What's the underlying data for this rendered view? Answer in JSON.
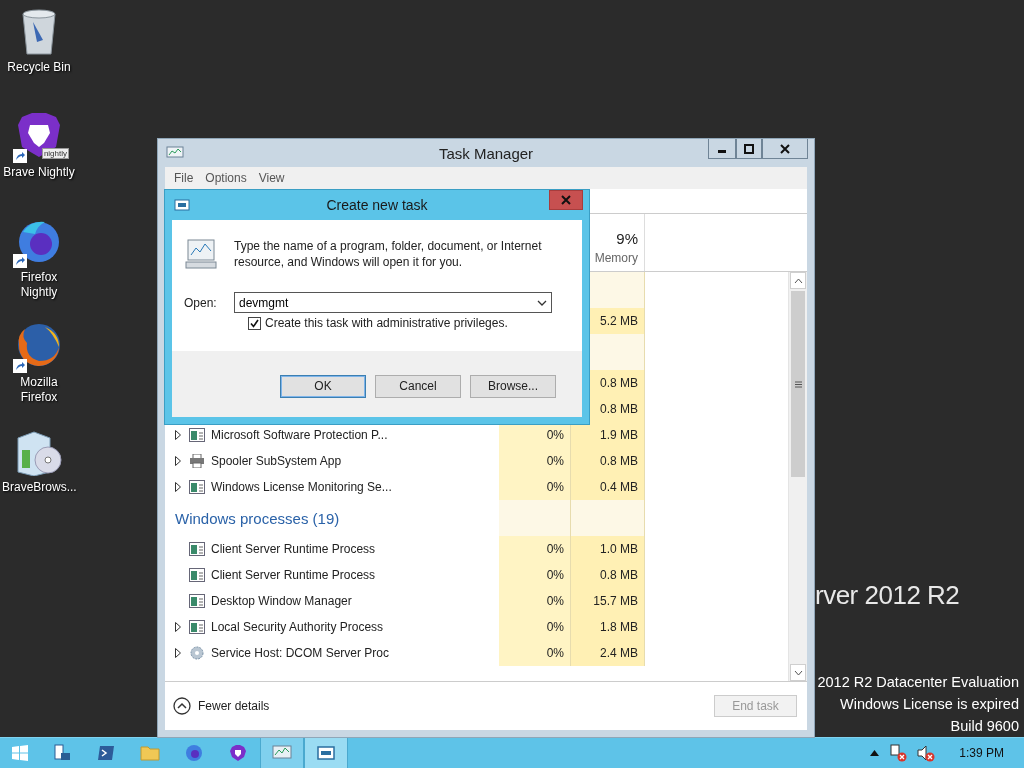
{
  "desktop_icons": [
    {
      "label": "Recycle Bin",
      "kind": "recycle",
      "shortcut": false
    },
    {
      "label": "Brave Nightly",
      "kind": "brave",
      "shortcut": true,
      "badge": "nightly"
    },
    {
      "label": "Firefox Nightly",
      "kind": "firefox-nightly",
      "shortcut": true
    },
    {
      "label": "Mozilla Firefox",
      "kind": "firefox",
      "shortcut": true
    },
    {
      "label": "BraveBrows...",
      "kind": "installer",
      "shortcut": false
    }
  ],
  "branding": {
    "title": "rver 2012 R2",
    "lines": [
      "2012 R2 Datacenter Evaluation",
      "Windows License is expired",
      "Build 9600"
    ]
  },
  "task_manager": {
    "title": "Task Manager",
    "menu": [
      "File",
      "Options",
      "View"
    ],
    "memory_header": {
      "percent": "9%",
      "label": "Memory"
    },
    "rows": [
      {
        "kind": "group"
      },
      {
        "kind": "covered",
        "memory": "5.2 MB"
      },
      {
        "kind": "group"
      },
      {
        "kind": "covered",
        "memory": "0.8 MB"
      },
      {
        "kind": "covered",
        "memory": "0.8 MB"
      },
      {
        "kind": "process",
        "name": "Microsoft Software Protection P...",
        "expandable": true,
        "cpu": "0%",
        "memory": "1.9 MB"
      },
      {
        "kind": "printer",
        "name": "Spooler SubSystem App",
        "expandable": true,
        "cpu": "0%",
        "memory": "0.8 MB"
      },
      {
        "kind": "process",
        "name": "Windows License Monitoring Se...",
        "expandable": true,
        "cpu": "0%",
        "memory": "0.4 MB"
      },
      {
        "kind": "group",
        "label": "Windows processes (19)"
      },
      {
        "kind": "process",
        "name": "Client Server Runtime Process",
        "expandable": false,
        "cpu": "0%",
        "memory": "1.0 MB"
      },
      {
        "kind": "process",
        "name": "Client Server Runtime Process",
        "expandable": false,
        "cpu": "0%",
        "memory": "0.8 MB"
      },
      {
        "kind": "process",
        "name": "Desktop Window Manager",
        "expandable": false,
        "cpu": "0%",
        "memory": "15.7 MB"
      },
      {
        "kind": "process",
        "name": "Local Security Authority Process",
        "expandable": true,
        "cpu": "0%",
        "memory": "1.8 MB"
      },
      {
        "kind": "service",
        "name": "Service Host: DCOM Server Proc",
        "expandable": true,
        "cpu": "0%",
        "memory": "2.4 MB"
      }
    ],
    "footer": {
      "toggle": "Fewer details",
      "end_task": {
        "label": "End task",
        "disabled": true
      }
    }
  },
  "dialog": {
    "title": "Create new task",
    "message": "Type the name of a program, folder, document, or Internet resource, and Windows will open it for you.",
    "open_label": "Open:",
    "value": "devmgmt",
    "admin": {
      "label": "Create this task with administrative privileges.",
      "checked": true
    },
    "buttons": [
      {
        "label": "OK",
        "default": true
      },
      {
        "label": "Cancel",
        "default": false
      },
      {
        "label": "Browse...",
        "default": false
      }
    ]
  },
  "taskbar": {
    "apps": [
      {
        "kind": "server-manager",
        "open": false,
        "selected": false
      },
      {
        "kind": "powershell",
        "open": false,
        "selected": false
      },
      {
        "kind": "explorer",
        "open": false,
        "selected": false
      },
      {
        "kind": "firefox",
        "open": false,
        "selected": false
      },
      {
        "kind": "brave",
        "open": false,
        "selected": false
      },
      {
        "kind": "task-manager",
        "open": true,
        "selected": false
      },
      {
        "kind": "run-dialog",
        "open": true,
        "selected": true
      }
    ],
    "clock": "1:39 PM"
  }
}
